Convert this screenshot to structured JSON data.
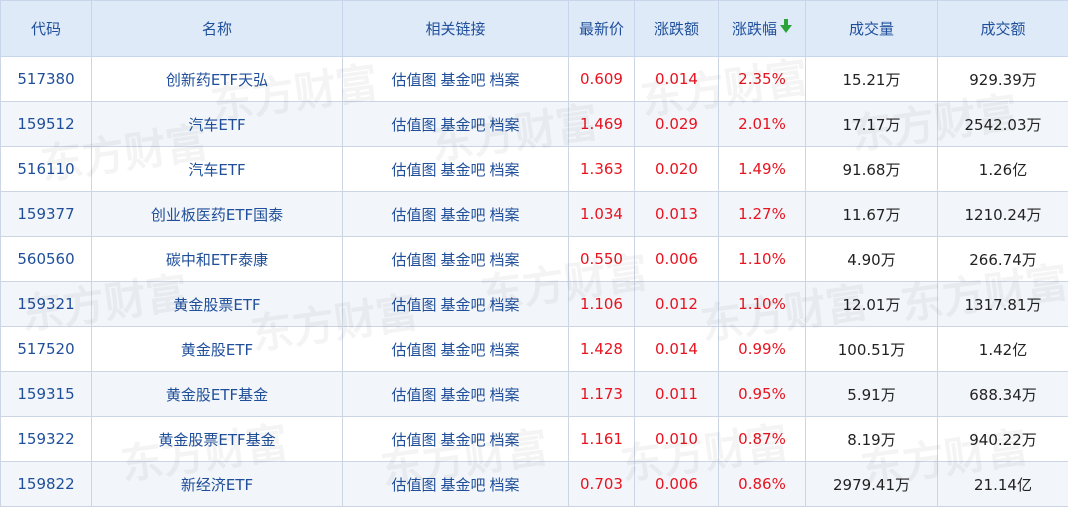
{
  "headers": [
    "代码",
    "名称",
    "相关链接",
    "最新价",
    "涨跌额",
    "涨跌幅",
    "成交量",
    "成交额"
  ],
  "link_labels": [
    "估值图",
    "基金吧",
    "档案"
  ],
  "watermark": "东方财富",
  "colors": {
    "header_bg": "#dfeaf8",
    "header_text": "#1f4f9a",
    "up": "#e8131f",
    "sort_arrow": "#2aa43a"
  },
  "rows": [
    {
      "code": "517380",
      "name": "创新药ETF天弘",
      "price": "0.609",
      "change": "0.014",
      "pct": "2.35%",
      "volume": "15.21万",
      "amount": "929.39万"
    },
    {
      "code": "159512",
      "name": "汽车ETF",
      "price": "1.469",
      "change": "0.029",
      "pct": "2.01%",
      "volume": "17.17万",
      "amount": "2542.03万"
    },
    {
      "code": "516110",
      "name": "汽车ETF",
      "price": "1.363",
      "change": "0.020",
      "pct": "1.49%",
      "volume": "91.68万",
      "amount": "1.26亿"
    },
    {
      "code": "159377",
      "name": "创业板医药ETF国泰",
      "price": "1.034",
      "change": "0.013",
      "pct": "1.27%",
      "volume": "11.67万",
      "amount": "1210.24万"
    },
    {
      "code": "560560",
      "name": "碳中和ETF泰康",
      "price": "0.550",
      "change": "0.006",
      "pct": "1.10%",
      "volume": "4.90万",
      "amount": "266.74万"
    },
    {
      "code": "159321",
      "name": "黄金股票ETF",
      "price": "1.106",
      "change": "0.012",
      "pct": "1.10%",
      "volume": "12.01万",
      "amount": "1317.81万"
    },
    {
      "code": "517520",
      "name": "黄金股ETF",
      "price": "1.428",
      "change": "0.014",
      "pct": "0.99%",
      "volume": "100.51万",
      "amount": "1.42亿"
    },
    {
      "code": "159315",
      "name": "黄金股ETF基金",
      "price": "1.173",
      "change": "0.011",
      "pct": "0.95%",
      "volume": "5.91万",
      "amount": "688.34万"
    },
    {
      "code": "159322",
      "name": "黄金股票ETF基金",
      "price": "1.161",
      "change": "0.010",
      "pct": "0.87%",
      "volume": "8.19万",
      "amount": "940.22万"
    },
    {
      "code": "159822",
      "name": "新经济ETF",
      "price": "0.703",
      "change": "0.006",
      "pct": "0.86%",
      "volume": "2979.41万",
      "amount": "21.14亿"
    }
  ]
}
